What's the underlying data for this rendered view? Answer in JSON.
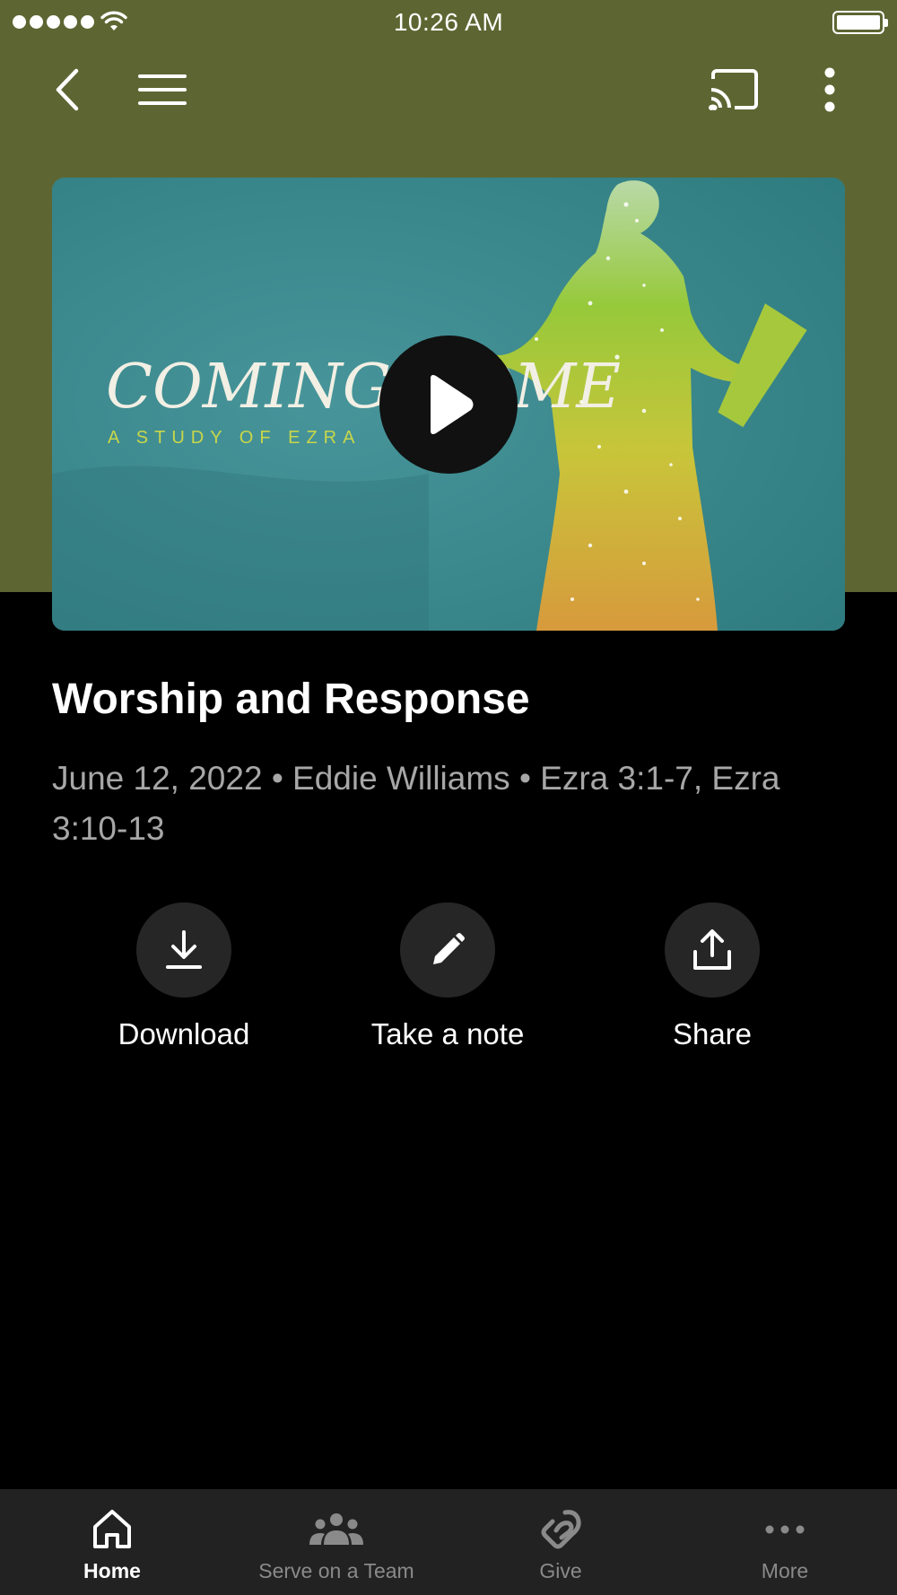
{
  "status_bar": {
    "time": "10:26 AM"
  },
  "nav": {
    "back_icon": "chevron-left-icon",
    "menu_icon": "hamburger-menu-icon",
    "cast_icon": "cast-icon",
    "more_icon": "more-vertical-icon"
  },
  "colors": {
    "header": "#5d6632",
    "background": "#000000",
    "tab_bar": "#222222",
    "action_circle": "#262626"
  },
  "hero": {
    "series_title": "COMING HOME",
    "series_subtitle": "A STUDY OF EZRA",
    "play_icon": "play-icon"
  },
  "sermon": {
    "title": "Worship and Response",
    "meta": "June 12, 2022 • Eddie Williams • Ezra 3:1-7, Ezra 3:10-13"
  },
  "actions": [
    {
      "label": "Download",
      "icon": "download-icon"
    },
    {
      "label": "Take a note",
      "icon": "pencil-icon"
    },
    {
      "label": "Share",
      "icon": "share-icon"
    }
  ],
  "tabs": [
    {
      "label": "Home",
      "icon": "home-icon",
      "active": true
    },
    {
      "label": "Serve on a Team",
      "icon": "people-icon",
      "active": false
    },
    {
      "label": "Give",
      "icon": "give-icon",
      "active": false
    },
    {
      "label": "More",
      "icon": "more-horizontal-icon",
      "active": false
    }
  ]
}
